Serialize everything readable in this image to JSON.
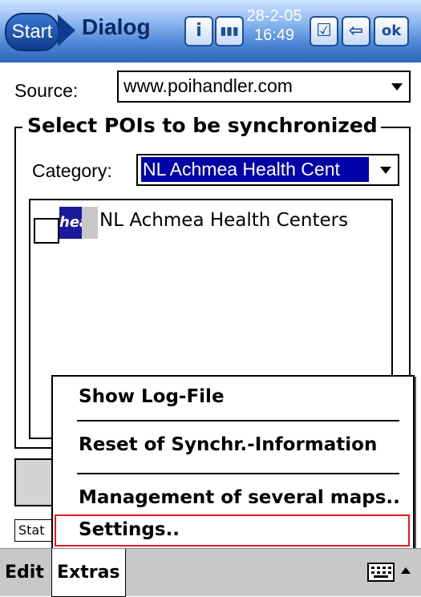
{
  "topbar": {
    "start_label": "Start",
    "title": "Dialog",
    "info_icon_glyph": "i",
    "date": "28-2-05",
    "time": "16:49",
    "ok_label": "ok"
  },
  "source": {
    "label": "Source:",
    "value": "www.poihandler.com"
  },
  "group": {
    "title": "Select POIs to be synchronized",
    "category_label": "Category:",
    "category_value": "NL Achmea Health Cent",
    "list_items": [
      {
        "label": "NL Achmea Health Centers",
        "checked": false,
        "icon": "heal"
      }
    ]
  },
  "status_text": "Stat",
  "popup_menu": {
    "items": [
      {
        "label": "Show Log-File"
      },
      {
        "label": "Reset of Synchr.-Information"
      },
      {
        "label": "Management of several maps.."
      },
      {
        "label": "Settings.."
      }
    ]
  },
  "menubar": {
    "edit_label": "Edit",
    "extras_label": "Extras"
  },
  "colors": {
    "selection": "#0000a8",
    "highlight_border": "#e01b24"
  }
}
